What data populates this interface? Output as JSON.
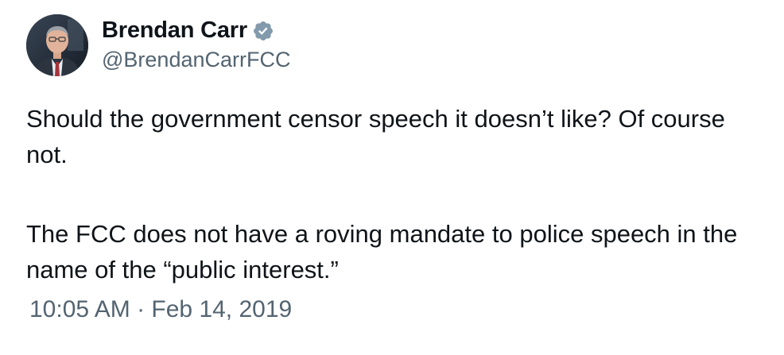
{
  "author": {
    "display_name": "Brendan Carr",
    "handle": "@BrendanCarrFCC",
    "verified_icon": "verified-badge-icon",
    "badge_color": "#829aab"
  },
  "tweet": {
    "paragraph_1": "Should the government censor speech it doesn’t like?  Of course not.",
    "paragraph_2": "The FCC does not have a roving mandate to police speech in the name of the “public interest.”",
    "timestamp": "10:05 AM · Feb 14, 2019"
  }
}
